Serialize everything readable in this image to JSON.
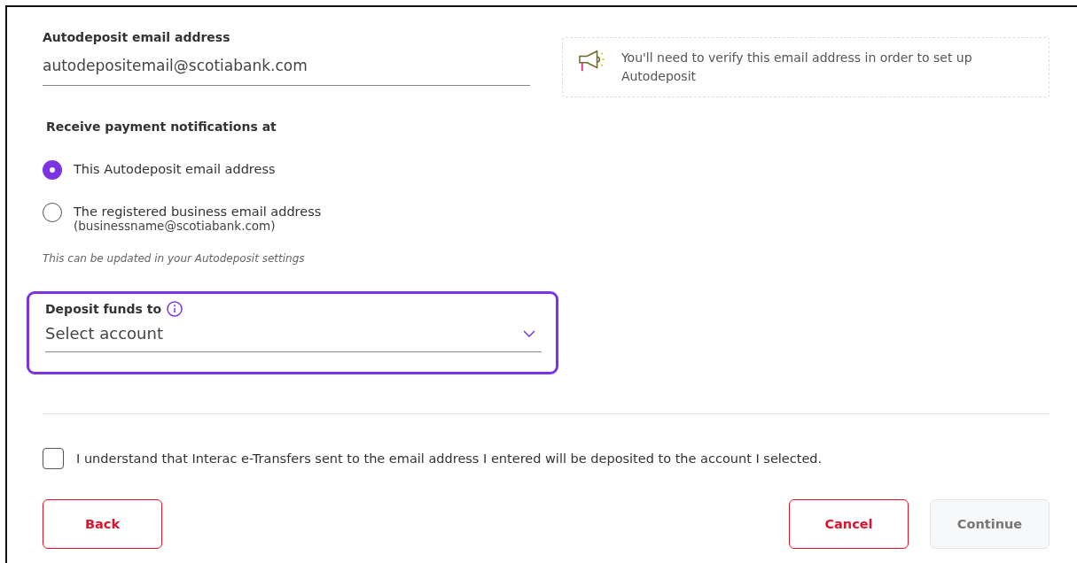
{
  "email_field": {
    "label": "Autodeposit email address",
    "value": "autodepositemail@scotiabank.com"
  },
  "callout": {
    "text": "You'll need to verify this email address in order to set up Autodeposit"
  },
  "notifications": {
    "heading": "Receive payment notifications at",
    "options": [
      {
        "label": "This Autodeposit email address",
        "selected": true
      },
      {
        "label": "The registered business email address",
        "sublabel": "(businessname@scotiabank.com)",
        "selected": false
      }
    ],
    "hint": "This can be updated in your Autodeposit settings"
  },
  "deposit_field": {
    "label": "Deposit funds to",
    "placeholder": "Select account",
    "focused": true
  },
  "agreement": {
    "text": "I understand that Interac e-Transfers sent to the email address I entered will be deposited to the account I selected.",
    "checked": false
  },
  "buttons": [
    {
      "label": "Back",
      "disabled": false
    },
    {
      "label": "Cancel",
      "disabled": false
    },
    {
      "label": "Continue",
      "disabled": true
    }
  ]
}
